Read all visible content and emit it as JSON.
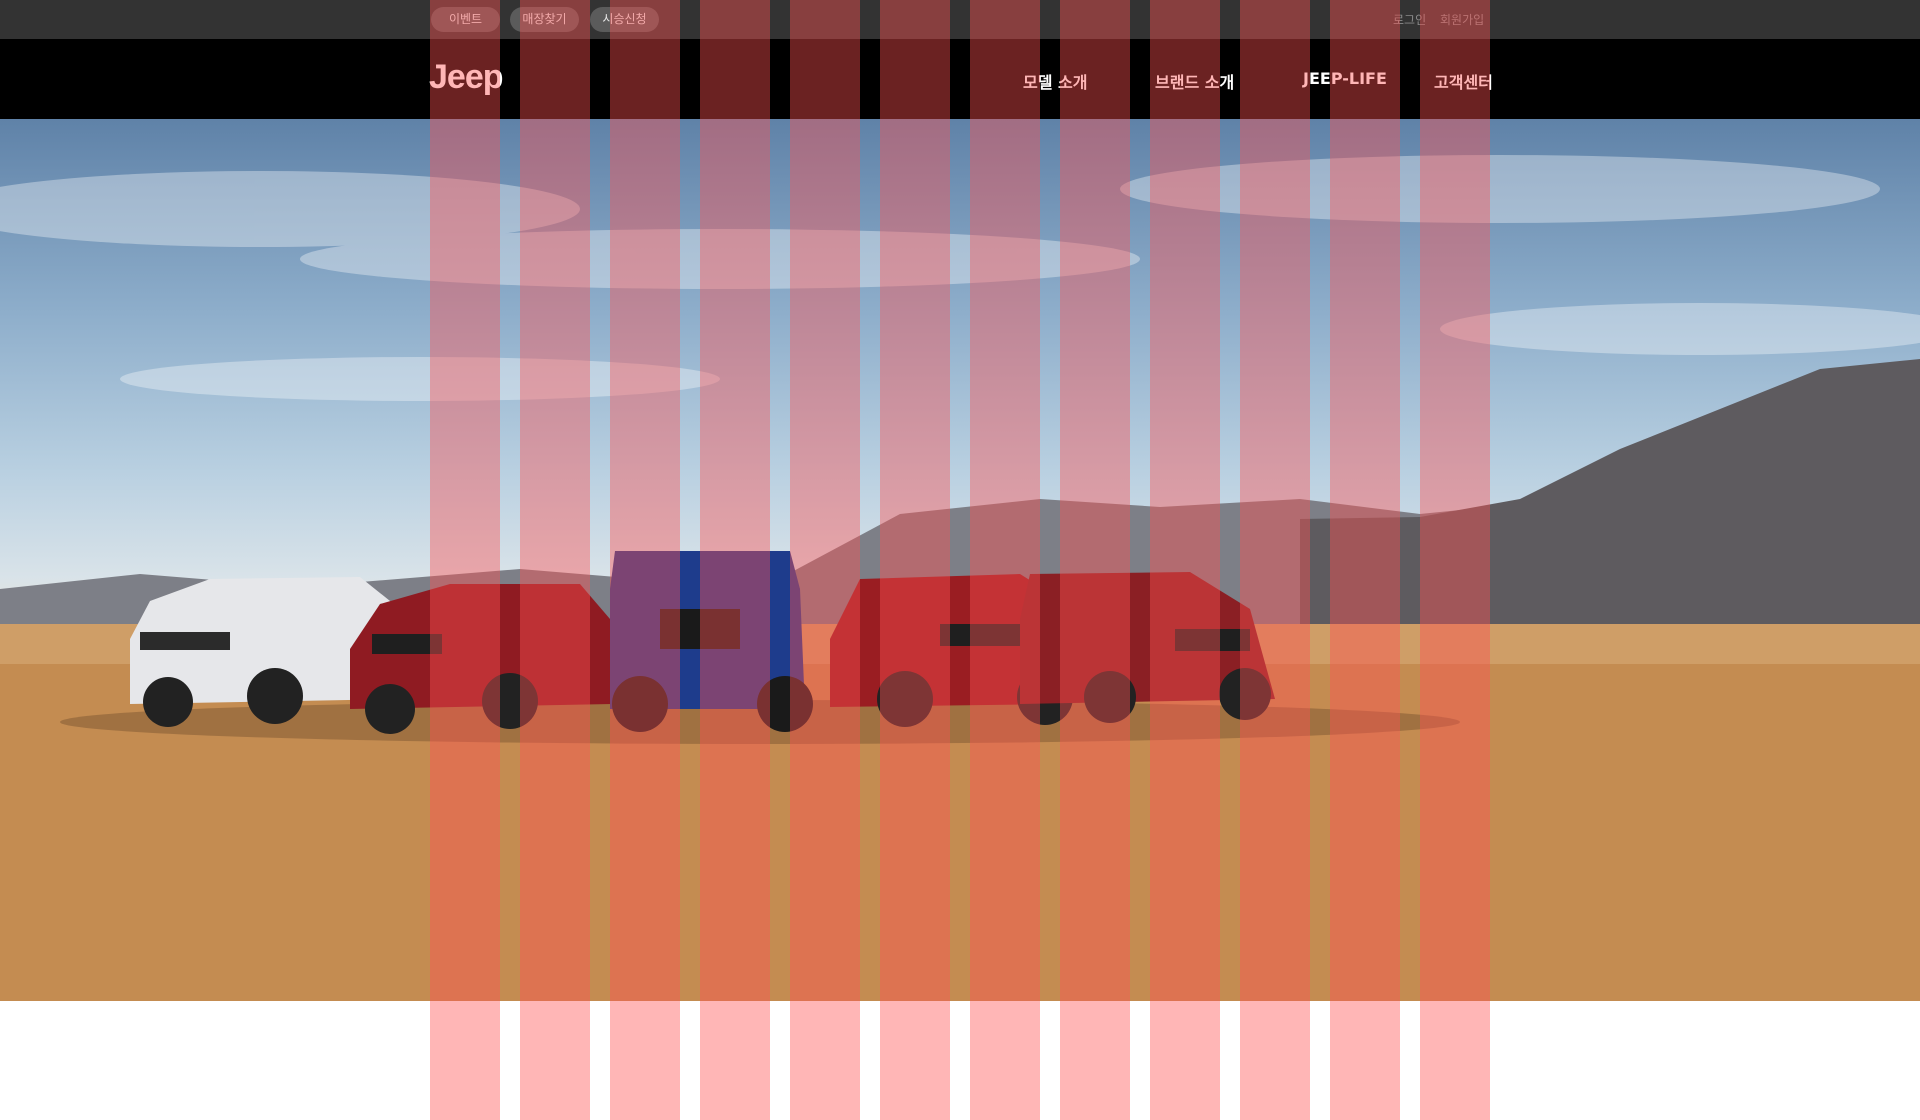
{
  "utility_bar": {
    "pills": [
      "이벤트",
      "매장찾기",
      "시승신청"
    ],
    "links": [
      "로그인",
      "회원가입"
    ]
  },
  "navbar": {
    "logo": "Jeep",
    "menu": [
      "모델 소개",
      "브랜드 소개",
      "JEEP-LIFE",
      "고객센터"
    ]
  },
  "hero": {
    "image": "lineup-of-jeep-vehicles-on-desert-lakebed"
  },
  "overlay": {
    "type": "layout-column-grid",
    "columns": 12,
    "color": "#ff5050"
  }
}
